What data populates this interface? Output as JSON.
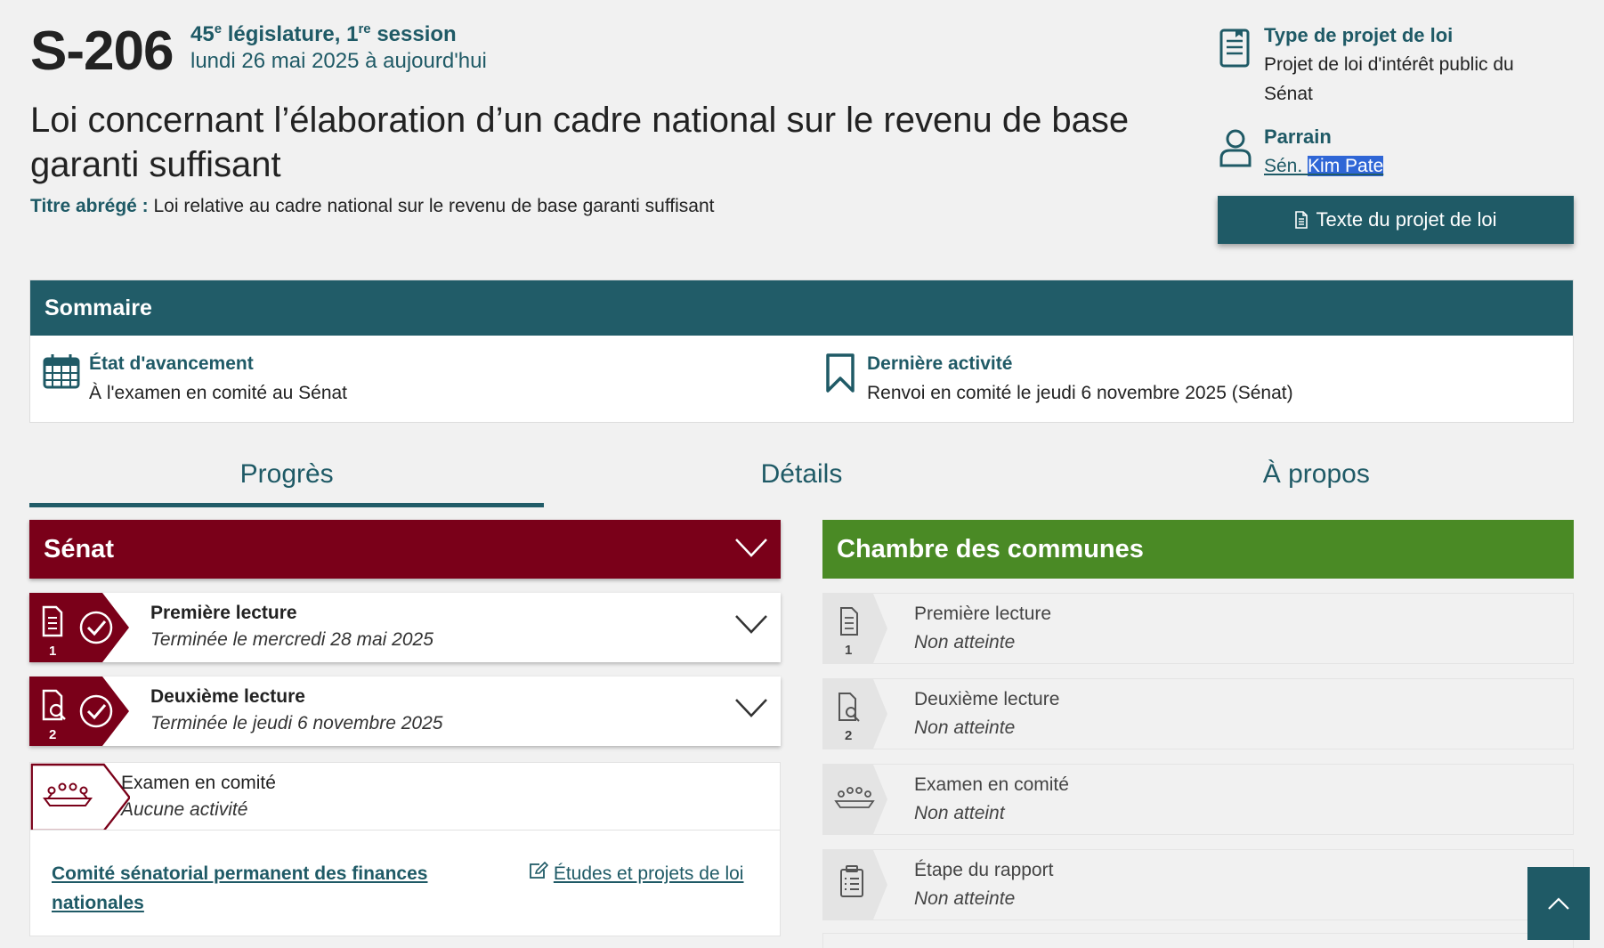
{
  "header": {
    "bill_number": "S-206",
    "legislature_num": "45",
    "legislature_sup": "e",
    "legislature_word": " législature, ",
    "session_num": "1",
    "session_sup": "re",
    "session_word": " session",
    "date_range": "lundi 26 mai 2025 à aujourd'hui",
    "title": "Loi concernant l’élaboration d’un cadre national sur le revenu de base garanti suffisant",
    "short_title_label": "Titre abrégé :",
    "short_title": " Loi relative au cadre national sur le revenu de base garanti suffisant"
  },
  "side": {
    "type_label": "Type de projet de loi",
    "type_value": "Projet de loi d'intérêt public du Sénat",
    "sponsor_label": "Parrain",
    "sponsor_prefix": "Sén. ",
    "sponsor_name": "Kim Pate",
    "bill_text_button": "Texte du projet de loi"
  },
  "summary": {
    "heading": "Sommaire",
    "status_label": "État d'avancement",
    "status_value": "À l'examen en comité au Sénat",
    "last_activity_label": "Dernière activité",
    "last_activity_value": "Renvoi en comité le jeudi 6 novembre 2025 (Sénat)"
  },
  "tabs": [
    {
      "label": "Progrès"
    },
    {
      "label": "Détails"
    },
    {
      "label": "À propos"
    }
  ],
  "senate": {
    "heading": "Sénat",
    "stages": [
      {
        "name": "Première lecture",
        "status": "Terminée le mercredi 28 mai 2025",
        "num": "1"
      },
      {
        "name": "Deuxième lecture",
        "status": "Terminée le jeudi 6 novembre 2025",
        "num": "2"
      },
      {
        "name": "Examen en comité",
        "status": "Aucune activité"
      }
    ],
    "committee_link": "Comité sénatorial permanent des finances nationales",
    "studies_link": "Études et projets de loi"
  },
  "commons": {
    "heading": "Chambre des communes",
    "stages": [
      {
        "name": "Première lecture",
        "status": "Non atteinte",
        "num": "1"
      },
      {
        "name": "Deuxième lecture",
        "status": "Non atteinte",
        "num": "2"
      },
      {
        "name": "Examen en comité",
        "status": "Non atteint"
      },
      {
        "name": "Étape du rapport",
        "status": "Non atteinte"
      }
    ]
  },
  "colors": {
    "teal": "#1f5a66",
    "senate": "#7a0019",
    "commons": "#4a8a25"
  }
}
